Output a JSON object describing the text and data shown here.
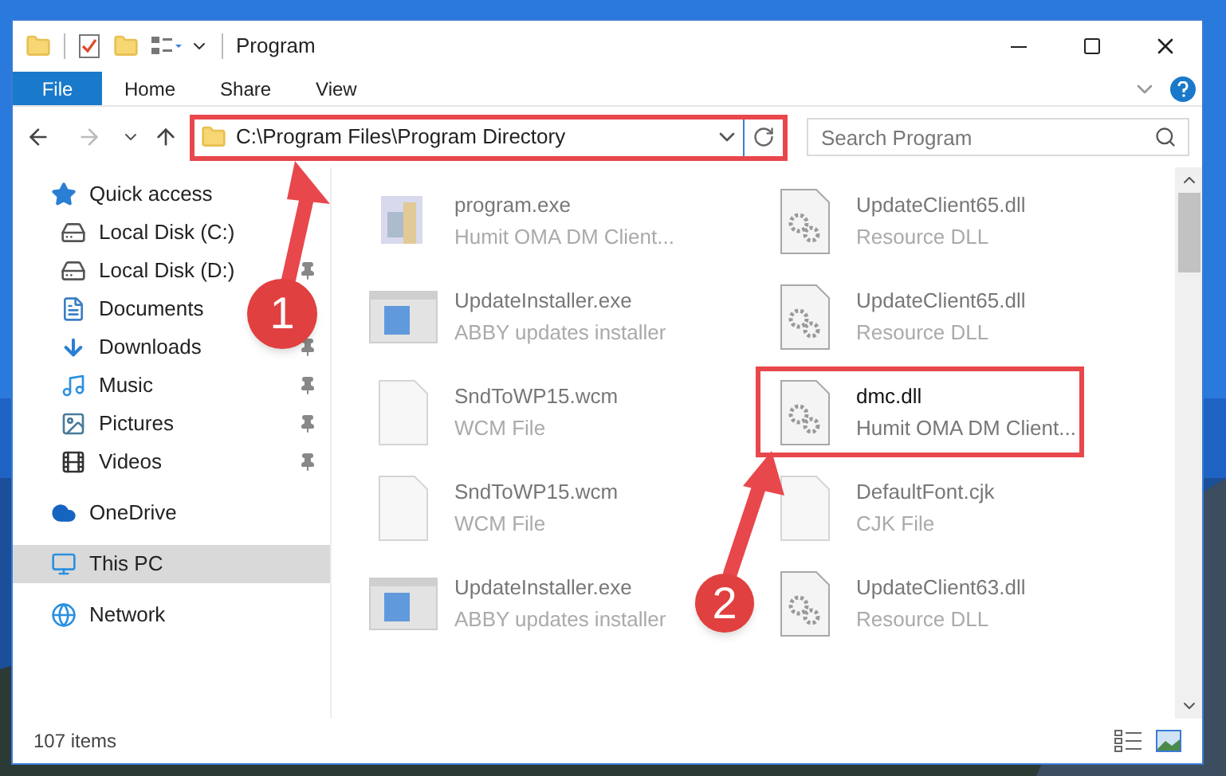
{
  "window": {
    "title": "Program"
  },
  "ribbon_tabs": [
    {
      "label": "File",
      "kind": "menu"
    },
    {
      "label": "Home",
      "kind": "tab"
    },
    {
      "label": "Share",
      "kind": "tab"
    },
    {
      "label": "View",
      "kind": "tab"
    }
  ],
  "address_bar": {
    "path": "C:\\Program Files\\Program Directory",
    "highlighted": true
  },
  "search": {
    "placeholder": "Search Program"
  },
  "navigation": [
    {
      "label": "Quick access",
      "kind": "star",
      "selected": false,
      "children": [
        {
          "label": "Local Disk (C:)",
          "kind": "systemdrive"
        },
        {
          "label": "Local Disk (D:)",
          "kind": "drive",
          "pinned": true
        },
        {
          "label": "Documents",
          "kind": "documents"
        },
        {
          "label": "Downloads",
          "kind": "downloads",
          "pinned": true
        },
        {
          "label": "Music",
          "kind": "music",
          "pinned": true
        },
        {
          "label": "Pictures",
          "kind": "pictures",
          "pinned": true
        },
        {
          "label": "Videos",
          "kind": "videos",
          "pinned": true
        }
      ]
    },
    {
      "label": "OneDrive",
      "kind": "cloud",
      "selected": false
    },
    {
      "label": "This PC",
      "kind": "pc",
      "selected": true
    },
    {
      "label": "Network",
      "kind": "network",
      "selected": false
    }
  ],
  "files": [
    {
      "name": "program.exe",
      "description": "Humit OMA DM Client...",
      "kind": "program",
      "highlighted": false
    },
    {
      "name": "UpdateClient65.dll",
      "description": "Resource DLL",
      "kind": "dll",
      "highlighted": false
    },
    {
      "name": "UpdateInstaller.exe",
      "description": "ABBY updates installer",
      "kind": "installer",
      "highlighted": false
    },
    {
      "name": "UpdateClient65.dll",
      "description": "Resource DLL",
      "kind": "dll",
      "highlighted": false
    },
    {
      "name": "SndToWP15.wcm",
      "description": "WCM File",
      "kind": "document",
      "highlighted": false
    },
    {
      "name": "dmc.dll",
      "description": "Humit OMA DM Client...",
      "kind": "dll",
      "highlighted": true
    },
    {
      "name": "SndToWP15.wcm",
      "description": "WCM File",
      "kind": "document",
      "highlighted": false
    },
    {
      "name": "DefaultFont.cjk",
      "description": "CJK File",
      "kind": "document",
      "highlighted": false
    },
    {
      "name": "UpdateInstaller.exe",
      "description": "ABBY updates installer",
      "kind": "installer",
      "highlighted": false
    },
    {
      "name": "UpdateClient63.dll",
      "description": "Resource DLL",
      "kind": "dll",
      "highlighted": false
    }
  ],
  "annotations": [
    {
      "label": "1"
    },
    {
      "label": "2"
    }
  ],
  "status_bar": {
    "count": "107 items"
  }
}
